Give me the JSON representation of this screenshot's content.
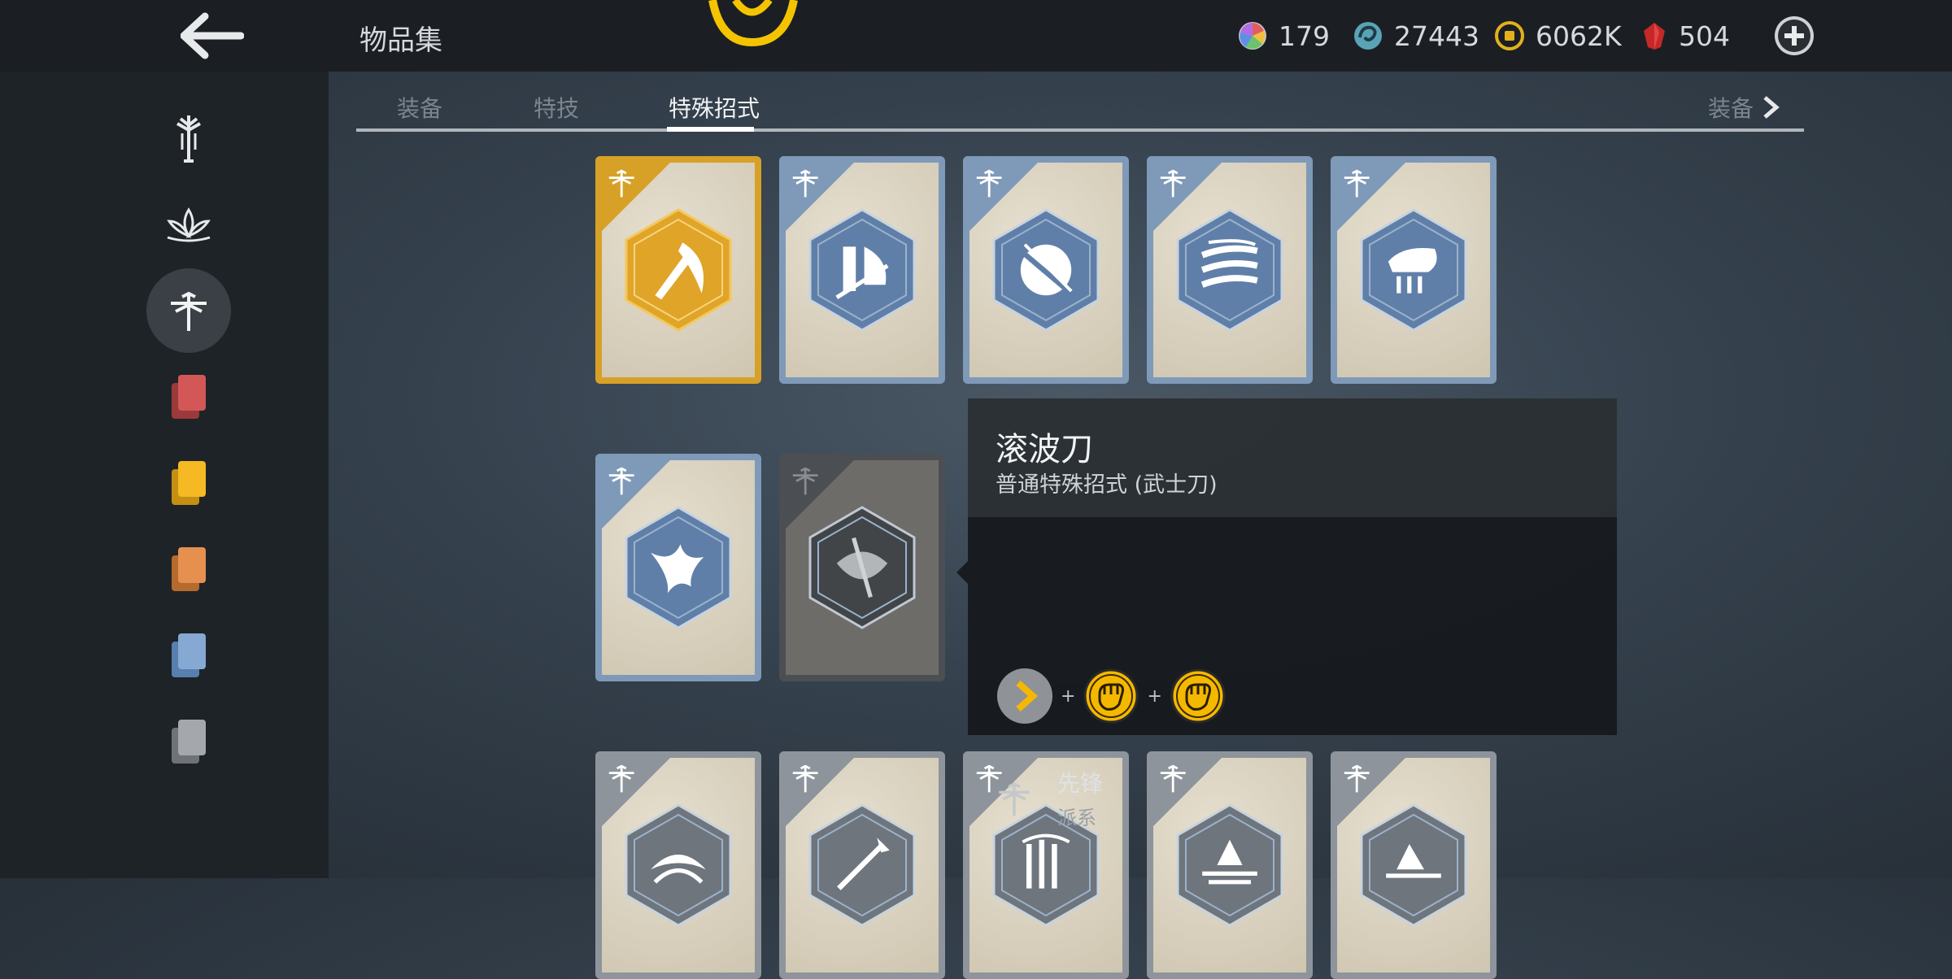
{
  "header": {
    "title": "物品集",
    "currencies": [
      {
        "name": "prism",
        "value": "179",
        "icon": "rainbow-orb-icon"
      },
      {
        "name": "swirl",
        "value": "27443",
        "icon": "swirl-orb-icon"
      },
      {
        "name": "coin",
        "value": "6062K",
        "icon": "coin-icon"
      },
      {
        "name": "ruby",
        "value": "504",
        "icon": "ruby-icon"
      }
    ]
  },
  "tabs": {
    "items": [
      {
        "label": "装备"
      },
      {
        "label": "特技"
      },
      {
        "label": "特殊招式",
        "active": true
      }
    ],
    "next_label": "装备"
  },
  "sidebar": {
    "items": [
      {
        "icon": "sword-emblem-icon"
      },
      {
        "icon": "lotus-icon"
      },
      {
        "icon": "dragonfly-icon",
        "active": true
      },
      {
        "icon": "red-cards-icon"
      },
      {
        "icon": "yellow-cards-icon"
      },
      {
        "icon": "orange-cards-icon"
      },
      {
        "icon": "blue-cards-icon"
      },
      {
        "icon": "grey-cards-icon"
      }
    ]
  },
  "cards": [
    {
      "rarity": "gold",
      "icon": "katana-slash-icon"
    },
    {
      "rarity": "blue",
      "icon": "blade-wall-icon"
    },
    {
      "rarity": "blue",
      "icon": "spinning-slash-icon"
    },
    {
      "rarity": "blue",
      "icon": "triple-slash-icon"
    },
    {
      "rarity": "blue",
      "icon": "horn-strike-icon"
    },
    {
      "rarity": "blue",
      "icon": "swallow-icon"
    },
    {
      "rarity": "locked",
      "icon": "axe-icon"
    },
    {
      "rarity": "grey",
      "icon": "crescent-icon"
    },
    {
      "rarity": "grey",
      "icon": "spear-icon"
    },
    {
      "rarity": "grey",
      "icon": "pillar-icon"
    },
    {
      "rarity": "grey",
      "icon": "ground-slash-icon"
    },
    {
      "rarity": "grey",
      "icon": "thrust-icon"
    }
  ],
  "popup": {
    "name": "滚波刀",
    "subtitle": "普通特殊招式 (武士刀)",
    "combo": [
      "direction-icon",
      "heavy-attack-icon",
      "heavy-attack-icon"
    ],
    "faction_name": "先锋",
    "faction_type": "派系"
  },
  "colors": {
    "gold": "#d7a127",
    "blue": "#7f9ab8",
    "grey": "#8d949b",
    "icon_blue": "#5f7fa8",
    "accent_yellow": "#f5b800"
  }
}
